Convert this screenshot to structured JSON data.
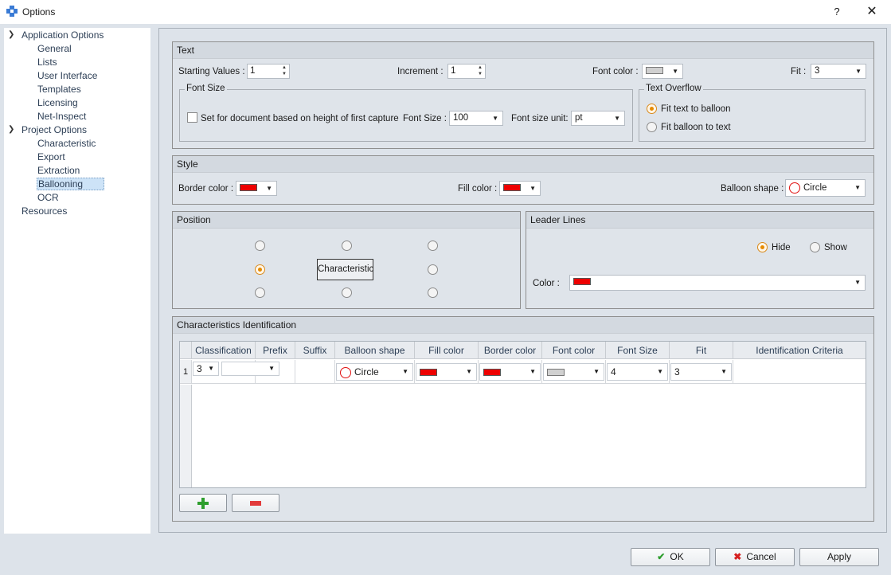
{
  "window": {
    "title": "Options",
    "help_label": "?",
    "close_label": "✕"
  },
  "tree": {
    "application_options": "Application Options",
    "app_items": [
      "General",
      "Lists",
      "User Interface",
      "Templates",
      "Licensing",
      "Net-Inspect"
    ],
    "project_options": "Project Options",
    "project_items": [
      "Characteristic",
      "Export",
      "Extraction",
      "Ballooning",
      "OCR"
    ],
    "resources": "Resources",
    "selected": "Ballooning"
  },
  "text_group": {
    "title": "Text",
    "starting_values_label": "Starting Values :",
    "starting_values": "1",
    "increment_label": "Increment :",
    "increment": "1",
    "font_color_label": "Font color :",
    "fit_label": "Fit :",
    "fit": "3",
    "font_size_frame": "Font Size",
    "set_for_document_label": "Set for document based on height of first capture",
    "font_size_label": "Font Size :",
    "font_size": "100",
    "font_size_unit_label": "Font size unit:",
    "font_size_unit": "pt",
    "text_overflow_frame": "Text Overflow",
    "fit_text_label": "Fit text to balloon",
    "fit_balloon_label": "Fit balloon to text"
  },
  "style_group": {
    "title": "Style",
    "border_color_label": "Border color :",
    "fill_color_label": "Fill color :",
    "balloon_shape_label": "Balloon shape :",
    "balloon_shape": "Circle"
  },
  "position_group": {
    "title": "Position",
    "center_label": "Characteristic"
  },
  "leader_lines": {
    "title": "Leader Lines",
    "hide_label": "Hide",
    "show_label": "Show",
    "color_label": "Color :"
  },
  "char_ident": {
    "title": "Characteristics Identification",
    "columns": [
      "Classification",
      "Prefix",
      "Suffix",
      "Balloon shape",
      "Fill color",
      "Border color",
      "Font color",
      "Font Size",
      "Fit",
      "Identification Criteria"
    ],
    "row": {
      "num": "1",
      "classification": "3",
      "balloon_shape": "Circle",
      "font_size": "4",
      "fit": "3"
    }
  },
  "buttons": {
    "ok": "OK",
    "cancel": "Cancel",
    "apply": "Apply"
  },
  "colors": {
    "red": "#ee0000",
    "light_gray": "#d0d0d0",
    "accent_orange": "#e68a00",
    "green_plus": "#2e9e2e"
  }
}
